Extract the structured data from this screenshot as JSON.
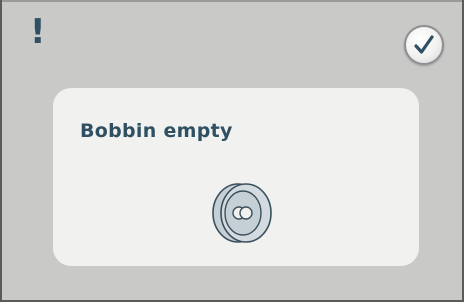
{
  "alert": {
    "symbol": "!",
    "icon": "exclamation-icon"
  },
  "confirm": {
    "icon": "checkmark-icon"
  },
  "message": {
    "title": "Bobbin empty",
    "icon": "bobbin-icon"
  },
  "colors": {
    "background": "#c9c9c7",
    "card": "#f1f1ef",
    "text": "#2f4f62",
    "icon_fill": "#c5cfd6",
    "icon_stroke": "#3a4f5c"
  }
}
